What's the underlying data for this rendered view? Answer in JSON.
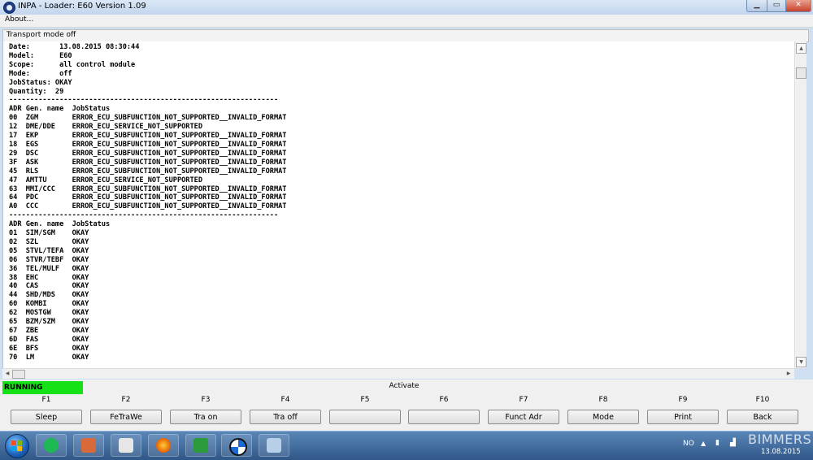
{
  "window": {
    "title": "INPA - Loader: E60 Version 1.09"
  },
  "menu": {
    "about": "About..."
  },
  "status_line": "Transport mode off",
  "report": {
    "header": [
      "Date:       13.08.2015 08:30:44",
      "Model:      E60",
      "Scope:      all control module",
      "Mode:       off",
      "JobStatus: OKAY",
      "Quantity:  29"
    ],
    "separator": "----------------------------------------------------------------",
    "col_header": "ADR Gen. name  JobStatus",
    "error_rows": [
      "00  ZGM        ERROR_ECU_SUBFUNCTION_NOT_SUPPORTED__INVALID_FORMAT",
      "12  DME/DDE    ERROR_ECU_SERVICE_NOT_SUPPORTED",
      "17  EKP        ERROR_ECU_SUBFUNCTION_NOT_SUPPORTED__INVALID_FORMAT",
      "18  EGS        ERROR_ECU_SUBFUNCTION_NOT_SUPPORTED__INVALID_FORMAT",
      "29  DSC        ERROR_ECU_SUBFUNCTION_NOT_SUPPORTED__INVALID_FORMAT",
      "3F  ASK        ERROR_ECU_SUBFUNCTION_NOT_SUPPORTED__INVALID_FORMAT",
      "45  RLS        ERROR_ECU_SUBFUNCTION_NOT_SUPPORTED__INVALID_FORMAT",
      "47  AMTTU      ERROR_ECU_SERVICE_NOT_SUPPORTED",
      "63  MMI/CCC    ERROR_ECU_SUBFUNCTION_NOT_SUPPORTED__INVALID_FORMAT",
      "64  PDC        ERROR_ECU_SUBFUNCTION_NOT_SUPPORTED__INVALID_FORMAT",
      "A0  CCC        ERROR_ECU_SUBFUNCTION_NOT_SUPPORTED__INVALID_FORMAT"
    ],
    "ok_rows": [
      "01  SIM/SGM    OKAY",
      "02  SZL        OKAY",
      "05  STVL/TEFA  OKAY",
      "06  STVR/TEBF  OKAY",
      "36  TEL/MULF   OKAY",
      "38  EHC        OKAY",
      "40  CAS        OKAY",
      "44  SHD/MDS    OKAY",
      "60  KOMBI      OKAY",
      "62  MOSTGW     OKAY",
      "65  BZM/SZM    OKAY",
      "67  ZBE        OKAY",
      "6D  FAS        OKAY",
      "6E  BFS        OKAY",
      "70  LM         OKAY"
    ]
  },
  "controls": {
    "running": "RUNNING",
    "activate": "Activate",
    "keys": [
      {
        "key": "F1",
        "label": "Sleep"
      },
      {
        "key": "F2",
        "label": "FeTraWe"
      },
      {
        "key": "F3",
        "label": "Tra on"
      },
      {
        "key": "F4",
        "label": "Tra off"
      },
      {
        "key": "F5",
        "label": ""
      },
      {
        "key": "F6",
        "label": ""
      },
      {
        "key": "F7",
        "label": "Funct Adr"
      },
      {
        "key": "F8",
        "label": "Mode"
      },
      {
        "key": "F9",
        "label": "Print"
      },
      {
        "key": "F10",
        "label": "Back"
      }
    ]
  },
  "taskbar": {
    "apps": [
      "spotify-icon",
      "briefcase-icon",
      "hp-icon",
      "firefox-icon",
      "ediabas-icon",
      "bmw-icon",
      "paint-icon"
    ],
    "language": "NO",
    "date": "13.08.2015",
    "watermark": "BIMMERS"
  },
  "colors": {
    "running_bg": "#16e016",
    "taskbar": "#2f5787"
  }
}
